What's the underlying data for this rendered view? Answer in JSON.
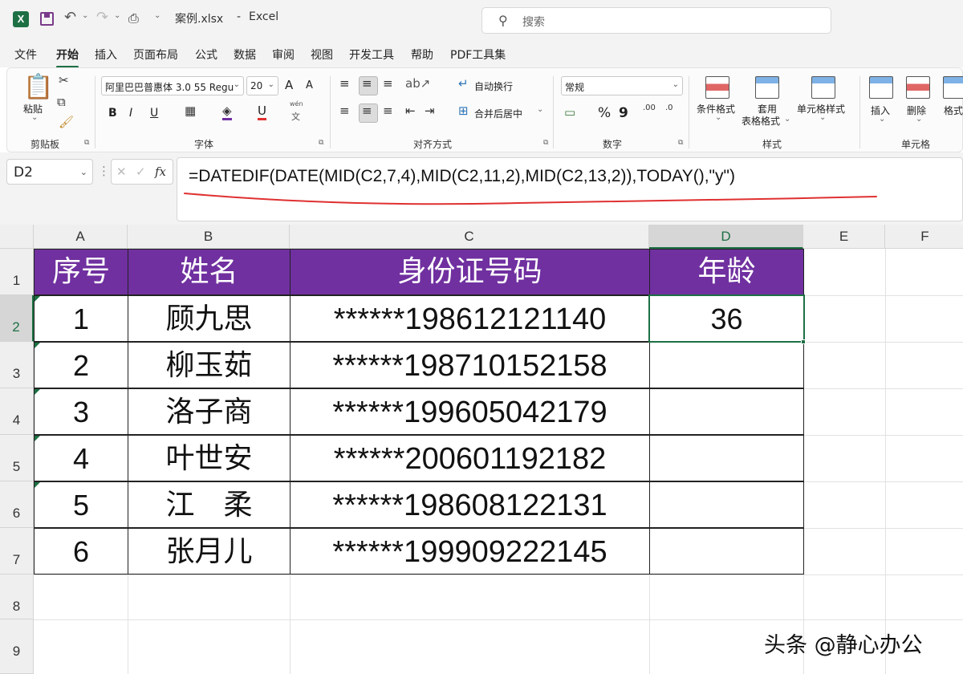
{
  "titlebar": {
    "filename": "案例.xlsx",
    "separator": "-",
    "app": "Excel",
    "search_placeholder": "搜索",
    "logo_letter": "X"
  },
  "menu": {
    "tabs": [
      "文件",
      "开始",
      "插入",
      "页面布局",
      "公式",
      "数据",
      "审阅",
      "视图",
      "开发工具",
      "帮助",
      "PDF工具集"
    ],
    "active_index": 1
  },
  "ribbon": {
    "clipboard": {
      "paste": "粘贴",
      "group": "剪贴板"
    },
    "font": {
      "name": "阿里巴巴普惠体 3.0 55 Regu",
      "size": "20",
      "grow": "A",
      "shrink": "A",
      "bold": "B",
      "italic": "I",
      "underline": "U",
      "phonetic_top": "wén",
      "phonetic_bottom": "文",
      "group": "字体"
    },
    "alignment": {
      "wrap": "自动换行",
      "merge": "合并后居中",
      "group": "对齐方式"
    },
    "number": {
      "format": "常规",
      "percent": "%",
      "comma": "9",
      "inc": "←0\n.00",
      "dec": ".00\n→0",
      "group": "数字"
    },
    "styles": {
      "conditional": "条件格式",
      "table1": "套用",
      "table2": "表格格式",
      "cell_styles": "单元格样式",
      "group": "样式"
    },
    "cells": {
      "insert": "插入",
      "delete": "删除",
      "format": "格式",
      "group": "单元格"
    }
  },
  "formula_bar": {
    "name_box": "D2",
    "fx": "fx",
    "formula": "=DATEDIF(DATE(MID(C2,7,4),MID(C2,11,2),MID(C2,13,2)),TODAY(),\"y\")"
  },
  "sheet": {
    "columns": [
      "A",
      "B",
      "C",
      "D",
      "E",
      "F"
    ],
    "rows": [
      "1",
      "2",
      "3",
      "4",
      "5",
      "6",
      "7",
      "8",
      "9"
    ],
    "header": [
      "序号",
      "姓名",
      "身份证号码",
      "年龄"
    ],
    "data": [
      [
        "1",
        "顾九思",
        "******198612121140",
        "36"
      ],
      [
        "2",
        "柳玉茹",
        "******198710152158",
        ""
      ],
      [
        "3",
        "洛子商",
        "******199605042179",
        ""
      ],
      [
        "4",
        "叶世安",
        "******200601192182",
        ""
      ],
      [
        "5",
        "江　柔",
        "******198608122131",
        ""
      ],
      [
        "6",
        "张月儿",
        "******199909222145",
        ""
      ]
    ],
    "header_color": "#7030a0",
    "accent_color": "#1d7044",
    "annotation_color": "#e03030"
  },
  "watermark": "头条 @静心办公"
}
